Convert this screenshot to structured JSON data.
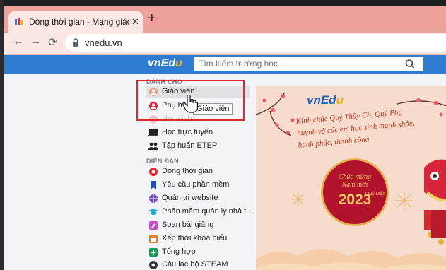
{
  "browser": {
    "tab_title": "Dòng thời gian - Mạng giáo dục",
    "tab_close": "✕",
    "new_tab": "+",
    "back": "←",
    "forward": "→",
    "reload": "⟳",
    "url": "vnedu.vn"
  },
  "header": {
    "logo_prefix": "vnEd",
    "logo_suffix": "u",
    "search_placeholder": "Tìm kiếm trường học",
    "search_icon": "search-icon"
  },
  "sidebar": {
    "section_danh_cho": "DÀNH CHO",
    "danh_cho_items": [
      {
        "label": "Giáo viên",
        "icon": "teacher-icon"
      },
      {
        "label": "Phụ h",
        "icon": "parent-icon"
      },
      {
        "label": "Học sinh",
        "icon": "student-icon"
      },
      {
        "label": "Học trực tuyến",
        "icon": "online-learning-icon"
      },
      {
        "label": "Tập huấn ETEP",
        "icon": "training-icon"
      }
    ],
    "section_dien_dan": "DIỄN ĐÀN",
    "dien_dan_items": [
      {
        "label": "Dòng thời gian",
        "icon": "timeline-icon"
      },
      {
        "label": "Yêu cầu phần mềm",
        "icon": "bookmark-icon"
      },
      {
        "label": "Quản trị website",
        "icon": "globe-icon"
      },
      {
        "label": "Phần mềm quản lý nhà t...",
        "icon": "graduation-icon"
      },
      {
        "label": "Soạn bài giảng",
        "icon": "edit-icon"
      },
      {
        "label": "Xếp thời khóa biểu",
        "icon": "calendar-icon"
      },
      {
        "label": "Tổng hợp",
        "icon": "plus-box-icon"
      },
      {
        "label": "Câu lạc bộ STEAM",
        "icon": "steam-icon"
      }
    ]
  },
  "tooltip": "Giáo viên",
  "banner": {
    "logo_prefix": "vnEd",
    "logo_suffix": "u",
    "greeting": "Kính chúc Quý Thầy Cô, Quý Phụ huynh và các em học sinh mạnh khỏe, hạnh phúc, thành công",
    "circle_line1": "Chúc mừng",
    "circle_line2": "Năm mới",
    "year": "2023",
    "year_small": "Quý Mão"
  },
  "colors": {
    "tabstrip": "#eda39a",
    "header_blue": "#2e7bd1",
    "highlight_red": "#e3262f",
    "banner_bg": "#f7dccd"
  }
}
